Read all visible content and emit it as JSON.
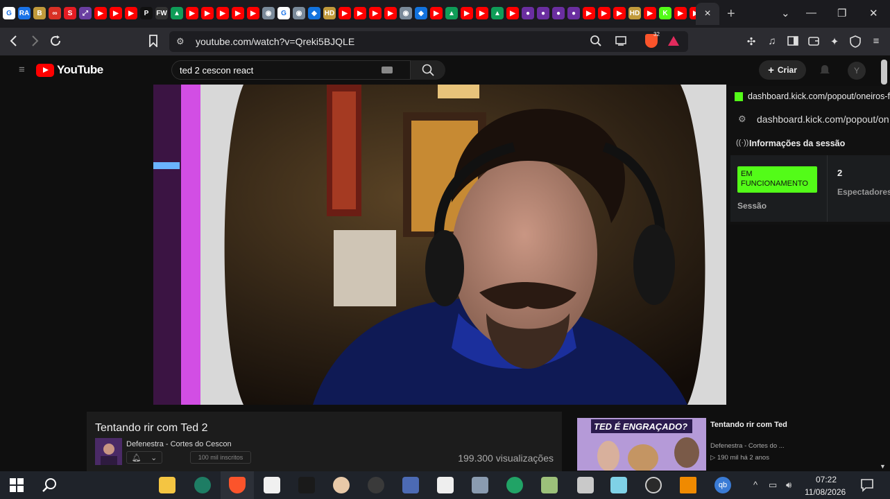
{
  "browser": {
    "url": "youtube.com/watch?v=Qreki5BJQLE",
    "brave_badge": "32",
    "tabs": {
      "favicons": [
        "G",
        "RA",
        "B",
        "∞",
        "S",
        "⤢",
        "▶",
        "▶",
        "▶",
        "P",
        "FW",
        "▲",
        "▶",
        "▶",
        "▶",
        "▶",
        "▶",
        "◉",
        "G",
        "◉",
        "◆",
        "HD",
        "▶",
        "▶",
        "▶",
        "▶",
        "◉",
        "◆",
        "▶",
        "▲",
        "▶",
        "▶",
        "▲",
        "▶",
        "●",
        "●",
        "●",
        "●",
        "▶",
        "▶",
        "▶",
        "HD",
        "▶",
        "K",
        "▶",
        "▶"
      ],
      "active_close": "×"
    }
  },
  "youtube": {
    "logo_text": "YouTube",
    "search_value": "ted 2 cescon react",
    "create_label": "Criar",
    "avatar_letter": "Y"
  },
  "kick_popout": {
    "domain_line": "dashboard.kick.com/popout/oneiros-fc",
    "address_line": "dashboard.kick.com/popout/on",
    "section_title": "Informações da sessão",
    "status_label": "EM FUNCIONAMENTO",
    "session_label": "Sessão",
    "viewers_value": "2",
    "viewers_label": "Espectadores"
  },
  "video_info": {
    "title": "Tentando rir com Ted 2",
    "channel": "Defenestra - Cortes do Cescon",
    "subscribers": "100 mil inscritos",
    "views": "199.300 visualizações"
  },
  "related": {
    "thumb_text": "TED É ENGRAÇADO?",
    "title": "Tentando rir com Ted",
    "channel": "Defenestra - Cortes do ...",
    "views": "190 mil",
    "age": "há 2 anos"
  },
  "taskbar": {
    "time": "07:22",
    "date": "11/08/2026"
  },
  "colors": {
    "youtube_red": "#ff0000",
    "kick_green": "#53fc18",
    "browser_dark": "#1b1b1f"
  }
}
